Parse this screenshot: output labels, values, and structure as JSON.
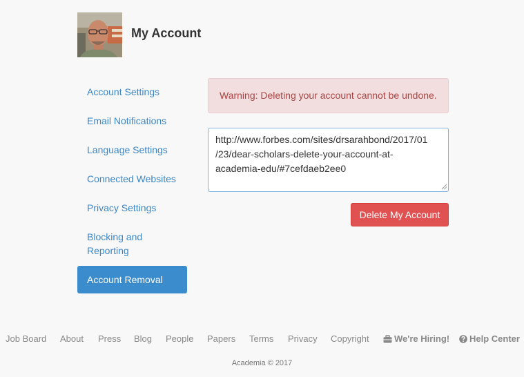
{
  "header": {
    "title": "My Account"
  },
  "sidebar": {
    "items": [
      {
        "label": "Account Settings"
      },
      {
        "label": "Email Notifications"
      },
      {
        "label": "Language Settings"
      },
      {
        "label": "Connected Websites"
      },
      {
        "label": "Privacy Settings"
      },
      {
        "label": "Blocking and",
        "label2": "Reporting"
      },
      {
        "label": "Account Removal"
      }
    ],
    "active_index": 6
  },
  "main": {
    "warning": "Warning: Deleting your account cannot be undone.",
    "url_value": "http://www.forbes.com/sites/drsarahbond/2017/01/23/dear-scholars-delete-your-account-at-academia-edu/#7cefdaeb2ee0",
    "url_lines": [
      "http://www.forbes.com/sites/drsarahbond/2017/01",
      "/23/dear-scholars-delete-your-account-at-",
      "academia-edu/#7cefdaeb2ee0"
    ],
    "delete_label": "Delete My Account"
  },
  "footer": {
    "links": [
      {
        "label": "Job Board"
      },
      {
        "label": "About"
      },
      {
        "label": "Press"
      },
      {
        "label": "Blog"
      },
      {
        "label": "People"
      },
      {
        "label": "Papers"
      },
      {
        "label": "Terms"
      },
      {
        "label": "Privacy"
      },
      {
        "label": "Copyright"
      },
      {
        "label": "We're Hiring!",
        "icon": "briefcase-icon"
      },
      {
        "label": "Help Center",
        "icon": "question-circle-icon"
      }
    ],
    "copyright": "Academia © 2017"
  },
  "colors": {
    "link": "#3a87c8",
    "active_bg": "#3a8ccc",
    "alert_bg": "#f2dede",
    "alert_text": "#a94442",
    "danger": "#e05252"
  }
}
